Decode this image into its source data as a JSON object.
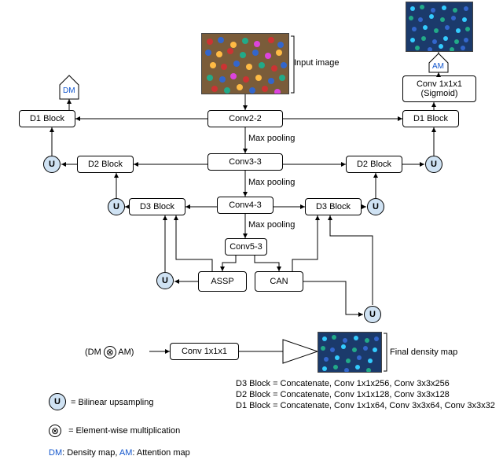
{
  "labels": {
    "input_image": "Input image",
    "conv22": "Conv2-2",
    "conv33": "Conv3-3",
    "conv43": "Conv4-3",
    "conv53": "Conv5-3",
    "assp": "ASSP",
    "can": "CAN",
    "maxpool1": "Max pooling",
    "maxpool2": "Max pooling",
    "maxpool3": "Max pooling",
    "d1_left": "D1 Block",
    "d2_left": "D2 Block",
    "d3_left": "D3 Block",
    "d1_right": "D1 Block",
    "d2_right": "D2 Block",
    "d3_right": "D3 Block",
    "conv_sigmoid": "Conv 1x1x1\n(Sigmoid)",
    "dm": "DM",
    "am": "AM",
    "u": "U",
    "dm_am_expr_pre": "(DM ",
    "dm_am_expr_post": " AM)",
    "conv111_final": "Conv 1x1x1",
    "final_density": "Final density map",
    "legend_d3": "D3 Block = Concatenate, Conv 1x1x256, Conv 3x3x256",
    "legend_d2": "D2 Block = Concatenate, Conv 1x1x128, Conv 3x3x128",
    "legend_d1": "D1 Block = Concatenate, Conv 1x1x64, Conv 3x3x64, Conv 3x3x32",
    "legend_u": "= Bilinear upsampling",
    "legend_otimes": "= Element-wise multiplication",
    "legend_maps": "DM: Density map, AM: Attention map"
  },
  "colors": {
    "dm": "#1155cc",
    "am": "#1155cc",
    "u_bg": "#cfe2f3"
  }
}
